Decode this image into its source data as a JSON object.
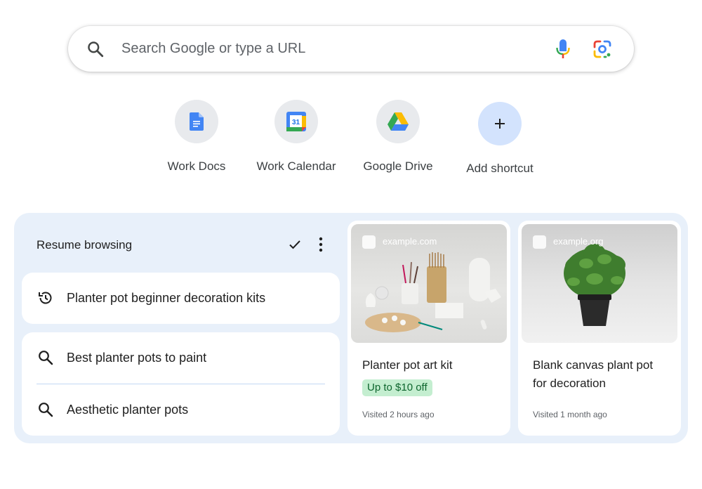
{
  "search": {
    "placeholder": "Search Google or type a URL"
  },
  "shortcuts": [
    {
      "label": "Work Docs",
      "icon": "docs-icon"
    },
    {
      "label": "Work Calendar",
      "icon": "calendar-icon",
      "calendar_day": "31"
    },
    {
      "label": "Google Drive",
      "icon": "drive-icon"
    },
    {
      "label": "Add shortcut",
      "icon": "plus-icon"
    }
  ],
  "resume": {
    "title": "Resume browsing",
    "history_item": "Planter pot beginner decoration kits",
    "suggestions": [
      "Best planter pots to paint",
      "Aesthetic planter pots"
    ],
    "tabs": [
      {
        "domain": "example.com",
        "title": "Planter pot art kit",
        "badge": "Up to $10 off",
        "visited": "Visited 2 hours ago"
      },
      {
        "domain": "example.org",
        "title_line1": "Blank canvas plant pot",
        "title_line2": "for decoration",
        "visited": "Visited 1 month ago"
      }
    ]
  },
  "colors": {
    "panel_bg": "#e8f0fa",
    "accent_blue": "#1a73e8",
    "badge_bg": "#c4eed0",
    "badge_text": "#0d652d"
  }
}
